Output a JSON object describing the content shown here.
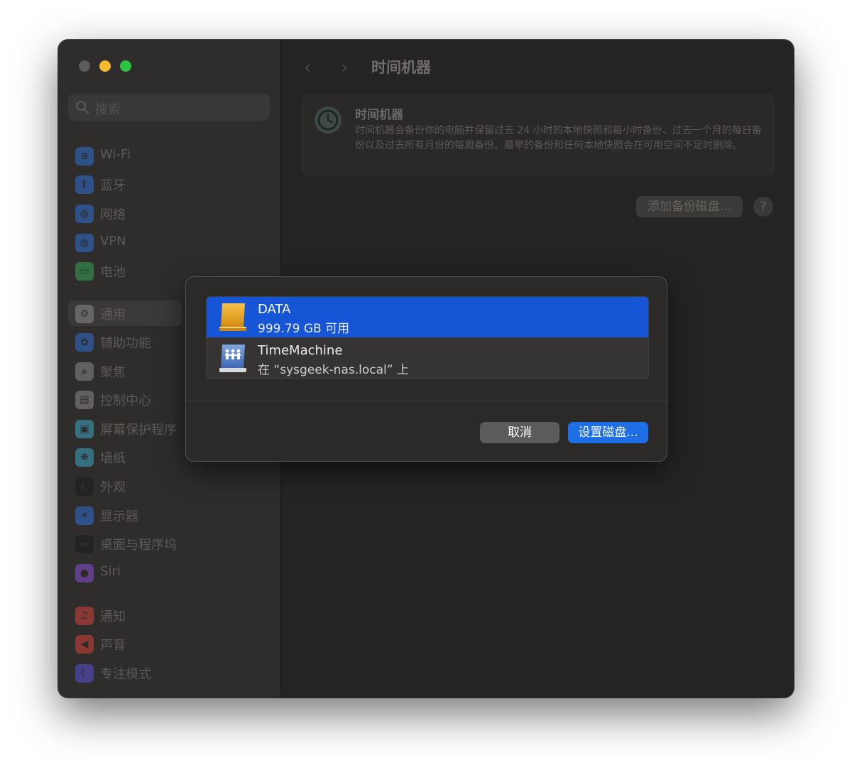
{
  "sidebar": {
    "search_placeholder": "搜索",
    "items": [
      {
        "label": "Wi-Fi",
        "icon": "wifi-icon",
        "color": "#2f6fd6"
      },
      {
        "label": "蓝牙",
        "icon": "bluetooth-icon",
        "color": "#2f6fd6"
      },
      {
        "label": "网络",
        "icon": "globe-icon",
        "color": "#2f6fd6"
      },
      {
        "label": "VPN",
        "icon": "vpn-globe-icon",
        "color": "#2f6fd6"
      },
      {
        "label": "电池",
        "icon": "battery-icon",
        "color": "#34a853"
      },
      {
        "label": "通用",
        "icon": "gear-icon",
        "color": "#8d8b89"
      },
      {
        "label": "辅助功能",
        "icon": "accessibility-icon",
        "color": "#2f6fd6"
      },
      {
        "label": "聚焦",
        "icon": "magnifier-icon",
        "color": "#8d8b89"
      },
      {
        "label": "控制中心",
        "icon": "control-center-icon",
        "color": "#8d8b89"
      },
      {
        "label": "屏幕保护程序",
        "icon": "screensaver-icon",
        "color": "#3aa6c8"
      },
      {
        "label": "墙纸",
        "icon": "wallpaper-icon",
        "color": "#3aa6c8"
      },
      {
        "label": "外观",
        "icon": "appearance-icon",
        "color": "#1c1c1c"
      },
      {
        "label": "显示器",
        "icon": "display-brightness-icon",
        "color": "#2f6fd6"
      },
      {
        "label": "桌面与程序坞",
        "icon": "dock-icon",
        "color": "#1c1c1c"
      },
      {
        "label": "Siri",
        "icon": "siri-icon",
        "color": "#8a4fd6"
      },
      {
        "label": "通知",
        "icon": "bell-icon",
        "color": "#d6423a"
      },
      {
        "label": "声音",
        "icon": "speaker-icon",
        "color": "#d6423a"
      },
      {
        "label": "专注模式",
        "icon": "moon-icon",
        "color": "#5a4fd6"
      }
    ],
    "selected_index": 5
  },
  "main": {
    "title": "时间机器",
    "back_icon": "chevron-left-icon",
    "forward_icon": "chevron-right-icon",
    "info": {
      "title": "时间机器",
      "description": "时间机器会备份你的电脑并保留过去 24 小时的本地快照和每小时备份、过去一个月的每日备份以及过去所有月份的每周备份。最早的备份和任何本地快照会在可用空间不足时删除。"
    },
    "add_disk_label": "添加备份磁盘...",
    "help_label": "?"
  },
  "dialog": {
    "disks": [
      {
        "name": "DATA",
        "detail": "999.79 GB 可用",
        "icon": "external-drive-icon",
        "selected": true
      },
      {
        "name": "TimeMachine",
        "detail": "在 “sysgeek-nas.local” 上",
        "icon": "network-drive-icon",
        "selected": false
      }
    ],
    "cancel_label": "取消",
    "setup_label": "设置磁盘..."
  },
  "colors": {
    "accent": "#1e6fe6",
    "selection": "#1656d6",
    "traffic_close": "#5e5c5a",
    "traffic_minimize": "#f6b92b",
    "traffic_maximize": "#2cc442"
  }
}
